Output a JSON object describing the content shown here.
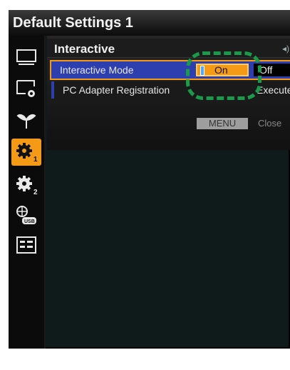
{
  "window": {
    "title": "Default Settings 1"
  },
  "sidebar": {
    "items": [
      {
        "icon": "display-icon"
      },
      {
        "icon": "display-settings-icon"
      },
      {
        "icon": "leaf-icon"
      },
      {
        "icon": "gear-1-icon",
        "badge": "1",
        "active": true
      },
      {
        "icon": "gear-2-icon",
        "badge": "2"
      },
      {
        "icon": "network-usb-icon",
        "badge": "USB"
      },
      {
        "icon": "info-list-icon"
      }
    ]
  },
  "panel": {
    "title": "Interactive",
    "scroll_indicator": "◂)",
    "rows": [
      {
        "label": "Interactive Mode",
        "selected_option": "On",
        "other_option": "Off"
      },
      {
        "label": "PC Adapter Registration",
        "action": "Execute"
      }
    ],
    "footer": {
      "menu_key": "MENU",
      "close_label": "Close"
    }
  },
  "colors": {
    "accent": "#f59a17",
    "selection": "#2d3fae",
    "highlight_ring": "#1a9a4a"
  }
}
